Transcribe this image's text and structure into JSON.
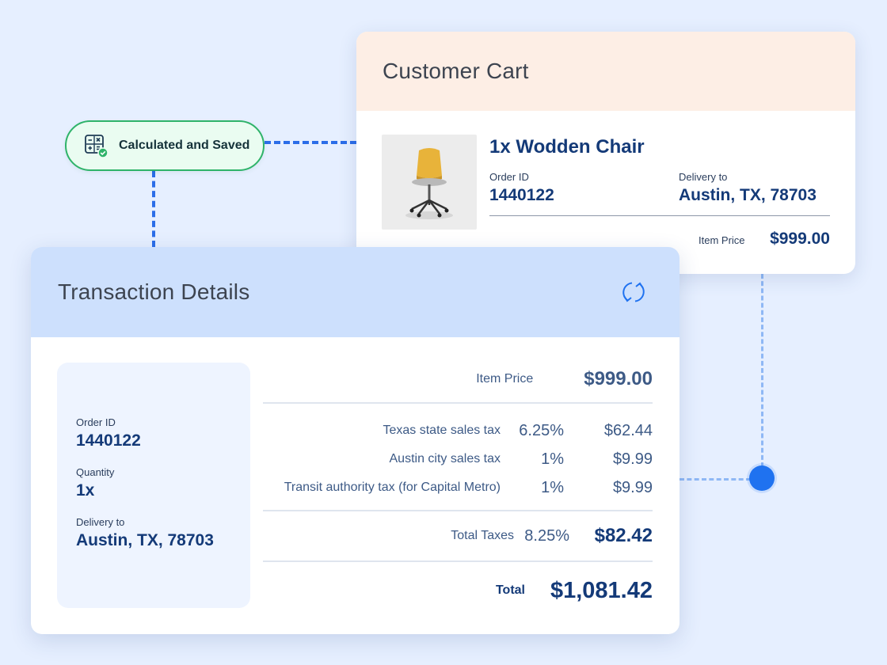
{
  "badge": {
    "label": "Calculated and Saved",
    "icon": "calculator-check-icon",
    "accent": "#2fb36a"
  },
  "cart": {
    "title": "Customer Cart",
    "product_name": "1x Wodden Chair",
    "product_image": "office-chair-image",
    "order_id_label": "Order ID",
    "order_id": "1440122",
    "delivery_label": "Delivery to",
    "delivery": "Austin, TX, 78703",
    "item_price_label": "Item Price",
    "item_price": "$999.00"
  },
  "transaction": {
    "title": "Transaction Details",
    "refresh_icon": "refresh-icon",
    "side": {
      "order_id_label": "Order ID",
      "order_id": "1440122",
      "quantity_label": "Quantity",
      "quantity": "1x",
      "delivery_label": "Delivery to",
      "delivery": "Austin, TX, 78703"
    },
    "item_price_label": "Item Price",
    "item_price": "$999.00",
    "taxes": [
      {
        "label": "Texas state sales tax",
        "rate": "6.25%",
        "amount": "$62.44"
      },
      {
        "label": "Austin city sales tax",
        "rate": "1%",
        "amount": "$9.99"
      },
      {
        "label": "Transit authority tax (for Capital Metro)",
        "rate": "1%",
        "amount": "$9.99"
      }
    ],
    "total_taxes_label": "Total Taxes",
    "total_taxes_rate": "8.25%",
    "total_taxes_amount": "$82.42",
    "total_label": "Total",
    "total_amount": "$1,081.42"
  },
  "colors": {
    "background": "#e6efff",
    "accent_blue": "#1f72f0",
    "cart_header": "#fdeee5",
    "transaction_header": "#cde0fd"
  }
}
